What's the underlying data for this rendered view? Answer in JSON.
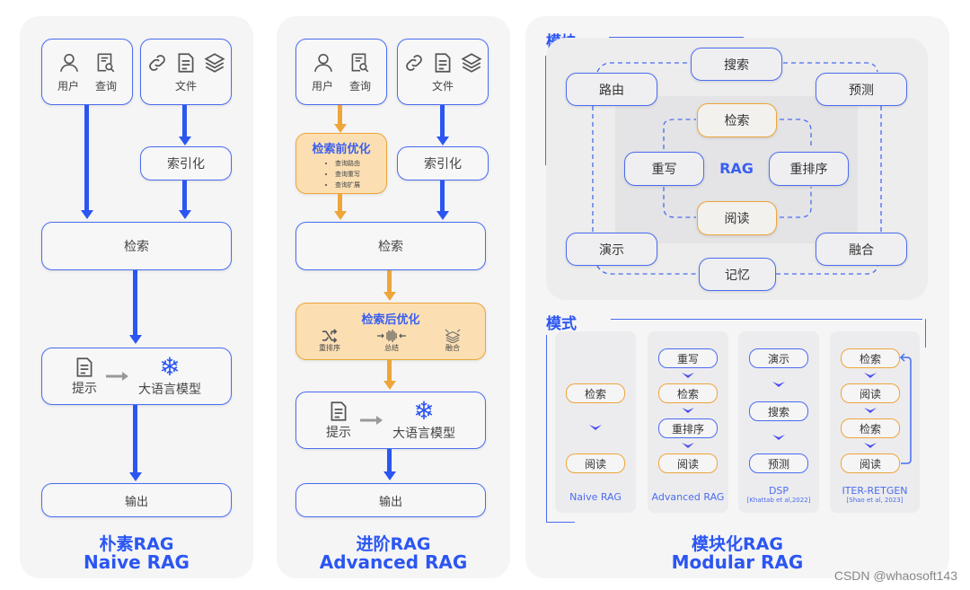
{
  "naive": {
    "input_user": "用户",
    "input_query": "查询",
    "input_files": "文件",
    "indexing": "索引化",
    "retrieval": "检索",
    "prompt": "提示",
    "llm": "大语言模型",
    "output": "输出",
    "title_cn": "朴素RAG",
    "title_en": "Naive RAG"
  },
  "advanced": {
    "input_user": "用户",
    "input_query": "查询",
    "input_files": "文件",
    "pre_retrieval": {
      "title": "检索前优化",
      "items": [
        "查询路由",
        "查询重写",
        "查询扩展"
      ]
    },
    "indexing": "索引化",
    "retrieval": "检索",
    "post_retrieval": {
      "title": "检索后优化",
      "items": [
        "重排序",
        "总结",
        "融合"
      ]
    },
    "prompt": "提示",
    "llm": "大语言模型",
    "output": "输出",
    "title_cn": "进阶RAG",
    "title_en": "Advanced RAG"
  },
  "modular": {
    "modules_heading": "模块",
    "outer_modules": {
      "search": "搜索",
      "routing": "路由",
      "predict": "预测",
      "demonstrate": "演示",
      "fusion": "融合",
      "memory": "记忆"
    },
    "inner_modules": {
      "retrieve": "检索",
      "rewrite": "重写",
      "rerank": "重排序",
      "read": "阅读",
      "center": "RAG"
    },
    "patterns_heading": "模式",
    "patterns": [
      {
        "name": "Naive RAG",
        "cite": "",
        "steps": [
          "检索",
          "阅读"
        ]
      },
      {
        "name": "Advanced RAG",
        "cite": "",
        "steps": [
          "重写",
          "检索",
          "重排序",
          "阅读"
        ]
      },
      {
        "name": "DSP",
        "cite": "[Khattab et al,2022]",
        "steps": [
          "演示",
          "搜索",
          "预测"
        ]
      },
      {
        "name": "ITER-RETGEN",
        "cite": "[Shao et al, 2023]",
        "steps": [
          "检索",
          "阅读",
          "检索",
          "阅读"
        ]
      }
    ],
    "title_cn": "模块化RAG",
    "title_en": "Modular RAG"
  },
  "watermark": "CSDN @whaosoft143",
  "colors": {
    "blue": "#2b56f2",
    "orange": "#eea53a",
    "panel": "#f5f5f6"
  }
}
